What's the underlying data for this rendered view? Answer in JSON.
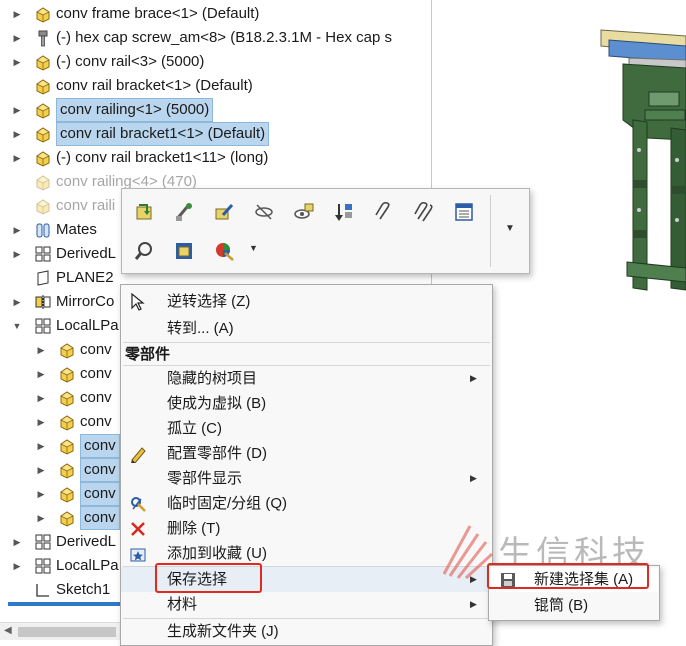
{
  "tree": {
    "items": [
      {
        "label": "conv frame brace<1> (Default)",
        "icon": "part-icon",
        "state": "normal"
      },
      {
        "label": "(-) hex cap screw_am<8> (B18.2.3.1M - Hex cap s",
        "icon": "screw-icon",
        "state": "normal"
      },
      {
        "label": "(-) conv rail<3> (5000)",
        "icon": "part-icon",
        "state": "normal"
      },
      {
        "label": "conv rail bracket<1> (Default)",
        "icon": "part-icon",
        "state": "normal"
      },
      {
        "label": "conv railing<1> (5000)",
        "icon": "part-icon",
        "state": "selected"
      },
      {
        "label": "conv rail bracket1<1> (Default)",
        "icon": "part-icon",
        "state": "selected"
      },
      {
        "label": "(-) conv rail bracket1<11> (long)",
        "icon": "part-icon",
        "state": "normal"
      },
      {
        "label": "conv railing<4> (470)",
        "icon": "part-icon",
        "state": "hidden"
      },
      {
        "label": "conv raili",
        "icon": "part-icon",
        "state": "hidden"
      },
      {
        "label": "Mates",
        "icon": "mates-icon",
        "state": "normal"
      },
      {
        "label": "DerivedL",
        "icon": "pattern-icon",
        "state": "normal"
      },
      {
        "label": "PLANE2",
        "icon": "plane-icon",
        "state": "normal"
      },
      {
        "label": "MirrorCo",
        "icon": "mirror-icon",
        "state": "normal"
      },
      {
        "label": "LocalLPa",
        "icon": "pattern-icon",
        "state": "normal"
      },
      {
        "label": "conv",
        "icon": "part-icon",
        "state": "normal"
      },
      {
        "label": "conv",
        "icon": "part-icon",
        "state": "normal"
      },
      {
        "label": "conv",
        "icon": "part-icon",
        "state": "normal"
      },
      {
        "label": "conv",
        "icon": "part-icon",
        "state": "normal"
      },
      {
        "label": "conv",
        "icon": "part-icon",
        "state": "selected"
      },
      {
        "label": "conv",
        "icon": "part-icon",
        "state": "selected"
      },
      {
        "label": "conv",
        "icon": "part-icon",
        "state": "selected"
      },
      {
        "label": "conv",
        "icon": "part-icon",
        "state": "selected"
      },
      {
        "label": "DerivedL",
        "icon": "pattern-icon",
        "state": "normal"
      },
      {
        "label": "LocalLPa",
        "icon": "pattern-icon",
        "state": "normal"
      },
      {
        "label": "Sketch1",
        "icon": "sketch-icon",
        "state": "normal"
      }
    ]
  },
  "toolbar": {
    "icons": [
      "insert-part-icon",
      "smart-mate-icon",
      "edit-part-icon",
      "hide-icon",
      "show-icon",
      "reorder-icon",
      "paperclip-icon",
      "paperclip-multi-icon",
      "properties-icon",
      "zoom-to-selection-icon",
      "isolate-icon",
      "appearance-icon"
    ]
  },
  "context_menu": {
    "invert_selection": "逆转选择 (Z)",
    "goto": "转到... (A)",
    "section_header": "零部件",
    "hide_tree_items": "隐藏的树项目",
    "make_virtual": "使成为虚拟 (B)",
    "isolate": "孤立 (C)",
    "configure_component": "配置零部件 (D)",
    "component_display": "零部件显示",
    "temp_fix_group": "临时固定/分组 (Q)",
    "delete": "删除 (T)",
    "add_to_favorites": "添加到收藏 (U)",
    "save_selection": "保存选择",
    "material": "材料",
    "new_folder": "生成新文件夹 (J)"
  },
  "submenu": {
    "new_selection_set": "新建选择集 (A)",
    "sleeve": "锟筒 (B)"
  },
  "watermark": {
    "text": "生信科技"
  },
  "colors": {
    "selection": "#b9d6ee",
    "annotation_red": "#e02a20",
    "frame_green": "#3f6b3f"
  }
}
